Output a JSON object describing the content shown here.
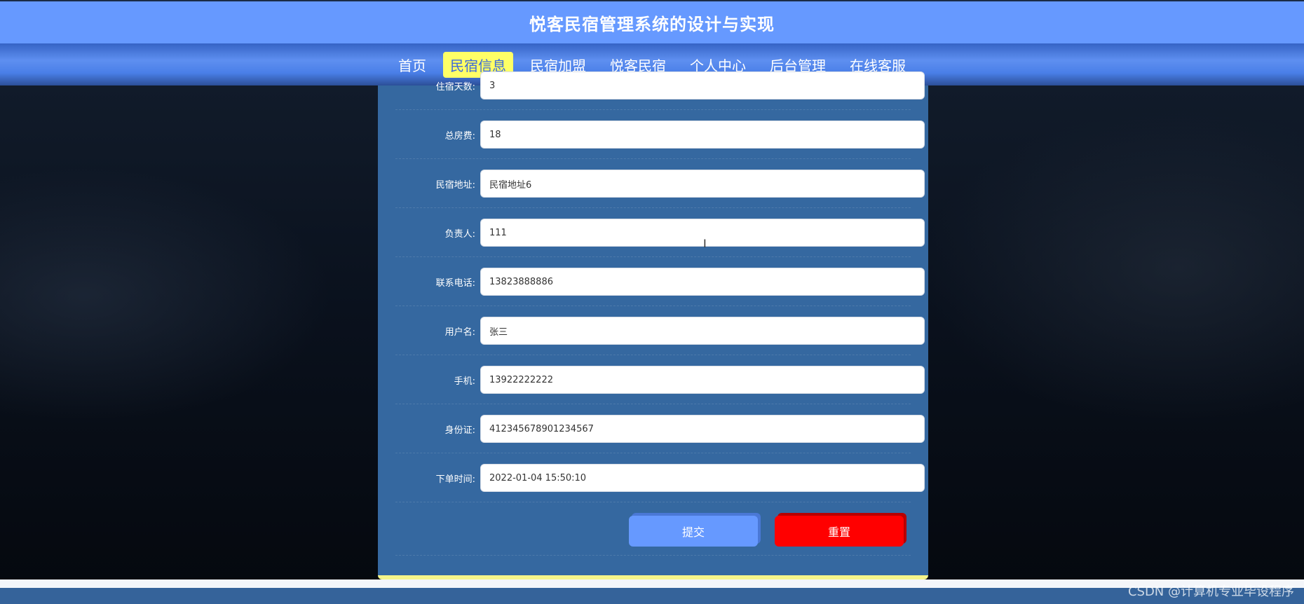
{
  "header": {
    "title": "悦客民宿管理系统的设计与实现"
  },
  "nav": {
    "items": [
      {
        "label": "首页",
        "active": false
      },
      {
        "label": "民宿信息",
        "active": true
      },
      {
        "label": "民宿加盟",
        "active": false
      },
      {
        "label": "悦客民宿",
        "active": false
      },
      {
        "label": "个人中心",
        "active": false
      },
      {
        "label": "后台管理",
        "active": false
      },
      {
        "label": "在线客服",
        "active": false
      }
    ]
  },
  "form": {
    "fields": [
      {
        "label": "住宿天数:",
        "value": "3"
      },
      {
        "label": "总房费:",
        "value": "18"
      },
      {
        "label": "民宿地址:",
        "value": "民宿地址6"
      },
      {
        "label": "负责人:",
        "value": "111"
      },
      {
        "label": "联系电话:",
        "value": "13823888886"
      },
      {
        "label": "用户名:",
        "value": "张三"
      },
      {
        "label": "手机:",
        "value": "13922222222"
      },
      {
        "label": "身份证:",
        "value": "412345678901234567"
      },
      {
        "label": "下单时间:",
        "value": "2022-01-04 15:50:10"
      }
    ],
    "submit_label": "提交",
    "reset_label": "重置"
  },
  "watermark": "CSDN @计算机专业毕设程序",
  "colors": {
    "header_bg": "#6699ff",
    "nav_active_bg": "#ffff66",
    "panel_bg": "#3568a0",
    "submit_bg": "#6699ff",
    "reset_bg": "#ff0000"
  }
}
